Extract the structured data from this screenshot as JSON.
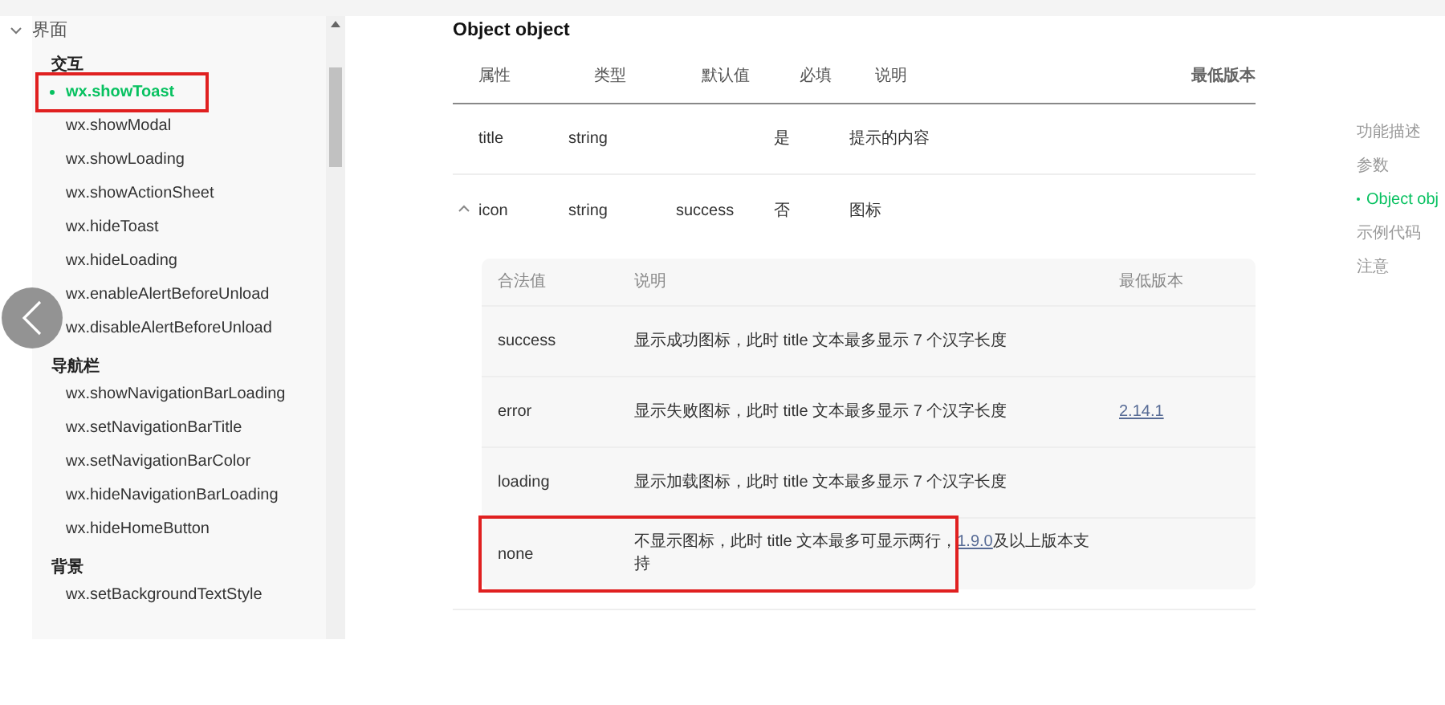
{
  "sidebar": {
    "section": {
      "label": "界面",
      "expanded": true
    },
    "groups": [
      {
        "title": "交互",
        "items": [
          {
            "label": "wx.showToast",
            "selected": true,
            "highlighted": true
          },
          {
            "label": "wx.showModal",
            "selected": false,
            "highlighted": false
          },
          {
            "label": "wx.showLoading",
            "selected": false,
            "highlighted": false
          },
          {
            "label": "wx.showActionSheet",
            "selected": false,
            "highlighted": false
          },
          {
            "label": "wx.hideToast",
            "selected": false,
            "highlighted": false
          },
          {
            "label": "wx.hideLoading",
            "selected": false,
            "highlighted": false
          },
          {
            "label": "wx.enableAlertBeforeUnload",
            "selected": false,
            "highlighted": false
          },
          {
            "label": "wx.disableAlertBeforeUnload",
            "selected": false,
            "highlighted": false
          }
        ]
      },
      {
        "title": "导航栏",
        "items": [
          {
            "label": "wx.showNavigationBarLoading",
            "selected": false,
            "highlighted": false
          },
          {
            "label": "wx.setNavigationBarTitle",
            "selected": false,
            "highlighted": false
          },
          {
            "label": "wx.setNavigationBarColor",
            "selected": false,
            "highlighted": false
          },
          {
            "label": "wx.hideNavigationBarLoading",
            "selected": false,
            "highlighted": false
          },
          {
            "label": "wx.hideHomeButton",
            "selected": false,
            "highlighted": false
          }
        ]
      },
      {
        "title": "背景",
        "items": [
          {
            "label": "wx.setBackgroundTextStyle",
            "selected": false,
            "highlighted": false
          }
        ]
      }
    ]
  },
  "content": {
    "title": "Object object",
    "table": {
      "columns": [
        "属性",
        "类型",
        "默认值",
        "必填",
        "说明",
        "最低版本"
      ],
      "rows": [
        {
          "cells": [
            "title",
            "string",
            "",
            "是",
            "提示的内容",
            ""
          ]
        },
        {
          "cells": [
            "icon",
            "string",
            "success",
            "否",
            "图标",
            ""
          ],
          "expanded": true
        }
      ]
    },
    "values_table": {
      "columns": [
        "合法值",
        "说明",
        "最低版本"
      ],
      "rows": [
        {
          "value": "success",
          "description": "显示成功图标，此时 title 文本最多显示 7 个汉字长度",
          "version": "",
          "highlighted": false
        },
        {
          "value": "error",
          "description": "显示失败图标，此时 title 文本最多显示 7 个汉字长度",
          "version": "2.14.1",
          "highlighted": false
        },
        {
          "value": "loading",
          "description": "显示加载图标，此时 title 文本最多显示 7 个汉字长度",
          "version": "",
          "highlighted": false
        },
        {
          "value": "none",
          "description": "不显示图标，此时 title 文本最多可显示两行，",
          "link": "1.9.0",
          "description_end": "及以上版本支持",
          "version": "",
          "highlighted": true
        }
      ]
    }
  },
  "toc": [
    {
      "label": "功能描述",
      "selected": false
    },
    {
      "label": "参数",
      "selected": false
    },
    {
      "label": "Object obj",
      "selected": true
    },
    {
      "label": "示例代码",
      "selected": false
    },
    {
      "label": "注意",
      "selected": false
    }
  ]
}
